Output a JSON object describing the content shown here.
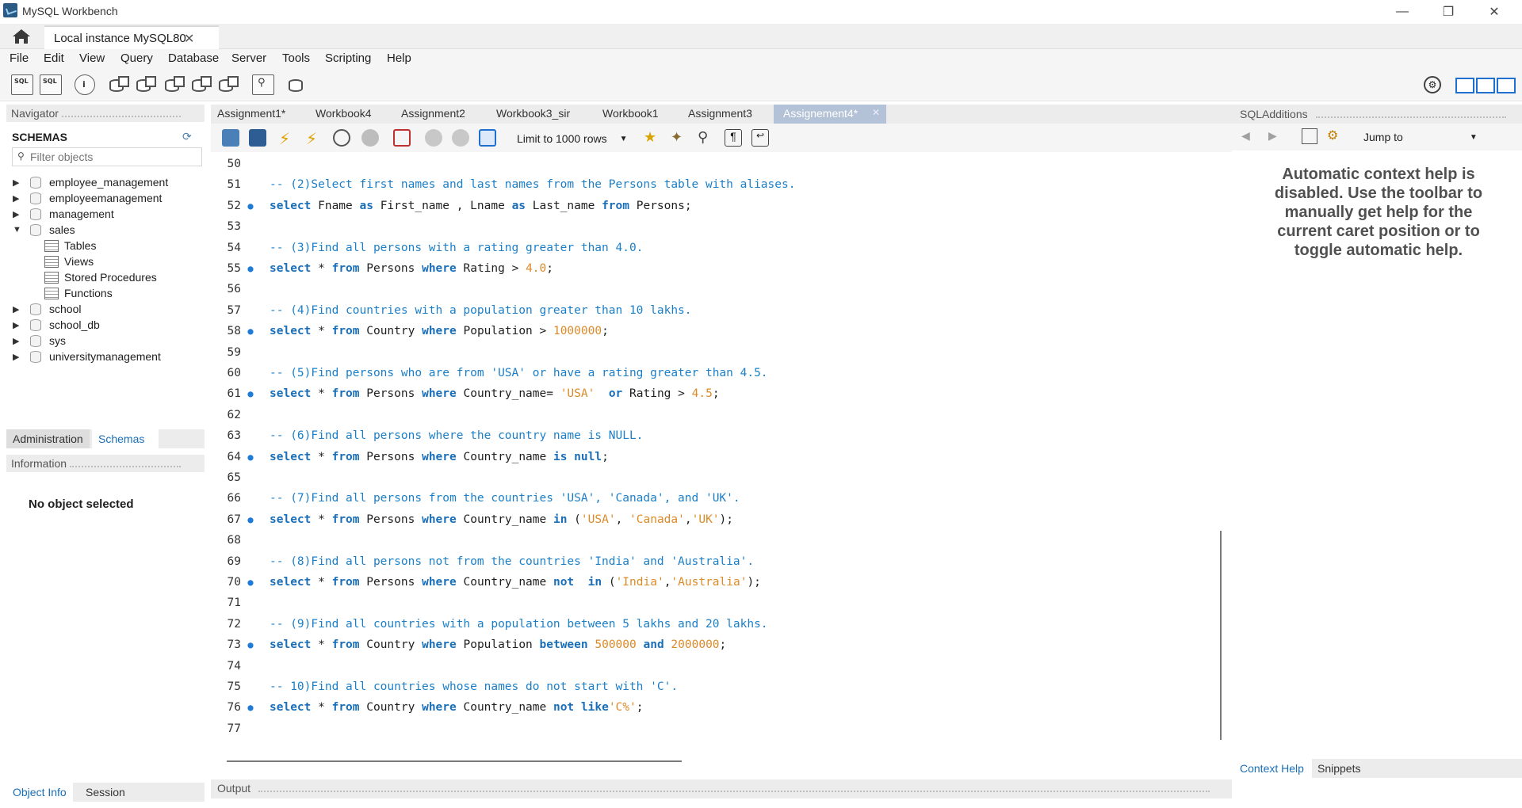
{
  "window": {
    "title": "MySQL Workbench",
    "connection_tab": "Local instance MySQL80"
  },
  "menu": [
    "File",
    "Edit",
    "View",
    "Query",
    "Database",
    "Server",
    "Tools",
    "Scripting",
    "Help"
  ],
  "toolbar_icons": [
    "new-sql-tab-icon",
    "open-sql-script-icon",
    "inspector-icon",
    "create-schema-icon",
    "create-table-icon",
    "create-view-icon",
    "create-procedure-icon",
    "create-function-icon",
    "search-table-data-icon",
    "reconnect-icon"
  ],
  "navigator": {
    "header": "Navigator",
    "schemas_label": "SCHEMAS",
    "filter_placeholder": "Filter objects",
    "schemas": [
      "employee_management",
      "employeemanagement",
      "management",
      "sales",
      "school",
      "school_db",
      "sys",
      "universitymanagement"
    ],
    "sales_children": [
      "Tables",
      "Views",
      "Stored Procedures",
      "Functions"
    ],
    "tabs": [
      "Administration",
      "Schemas"
    ],
    "information_header": "Information",
    "no_object": "No object selected",
    "bottom_tabs": [
      "Object Info",
      "Session"
    ]
  },
  "editor": {
    "tabs": [
      "Assignment1*",
      "Workbook4",
      "Assignment2",
      "Workbook3_sir",
      "Workbook1",
      "Assignment3"
    ],
    "active_tab": "Assignement4*",
    "limit_label": "Limit to 1000 rows",
    "output_label": "Output"
  },
  "code": [
    {
      "n": "50",
      "bp": false,
      "parts": []
    },
    {
      "n": "51",
      "bp": false,
      "parts": [
        [
          "cm",
          "-- (2)Select first names and last names from the Persons table with aliases."
        ]
      ]
    },
    {
      "n": "52",
      "bp": true,
      "parts": [
        [
          "kw",
          "select"
        ],
        [
          "ident",
          " Fname "
        ],
        [
          "kw",
          "as"
        ],
        [
          "ident",
          " First_name , Lname "
        ],
        [
          "kw",
          "as"
        ],
        [
          "ident",
          " Last_name "
        ],
        [
          "kw",
          "from"
        ],
        [
          "ident",
          " Persons;"
        ]
      ]
    },
    {
      "n": "53",
      "bp": false,
      "parts": []
    },
    {
      "n": "54",
      "bp": false,
      "parts": [
        [
          "cm",
          "-- (3)Find all persons with a rating greater than 4.0."
        ]
      ]
    },
    {
      "n": "55",
      "bp": true,
      "parts": [
        [
          "kw",
          "select"
        ],
        [
          "ident",
          " * "
        ],
        [
          "kw",
          "from"
        ],
        [
          "ident",
          " Persons "
        ],
        [
          "kw",
          "where"
        ],
        [
          "ident",
          " Rating > "
        ],
        [
          "num",
          "4.0"
        ],
        [
          "ident",
          ";"
        ]
      ]
    },
    {
      "n": "56",
      "bp": false,
      "parts": []
    },
    {
      "n": "57",
      "bp": false,
      "parts": [
        [
          "cm",
          "-- (4)Find countries with a population greater than 10 lakhs."
        ]
      ]
    },
    {
      "n": "58",
      "bp": true,
      "parts": [
        [
          "kw",
          "select"
        ],
        [
          "ident",
          " * "
        ],
        [
          "kw",
          "from"
        ],
        [
          "ident",
          " Country "
        ],
        [
          "kw",
          "where"
        ],
        [
          "ident",
          " Population > "
        ],
        [
          "num",
          "1000000"
        ],
        [
          "ident",
          ";"
        ]
      ]
    },
    {
      "n": "59",
      "bp": false,
      "parts": []
    },
    {
      "n": "60",
      "bp": false,
      "parts": [
        [
          "cm",
          "-- (5)Find persons who are from 'USA' or have a rating greater than 4.5."
        ]
      ]
    },
    {
      "n": "61",
      "bp": true,
      "parts": [
        [
          "kw",
          "select"
        ],
        [
          "ident",
          " * "
        ],
        [
          "kw",
          "from"
        ],
        [
          "ident",
          " Persons "
        ],
        [
          "kw",
          "where"
        ],
        [
          "ident",
          " Country_name= "
        ],
        [
          "str",
          "'USA'"
        ],
        [
          "ident",
          "  "
        ],
        [
          "kw",
          "or"
        ],
        [
          "ident",
          " Rating > "
        ],
        [
          "num",
          "4.5"
        ],
        [
          "ident",
          ";"
        ]
      ]
    },
    {
      "n": "62",
      "bp": false,
      "parts": []
    },
    {
      "n": "63",
      "bp": false,
      "parts": [
        [
          "cm",
          "-- (6)Find all persons where the country name is NULL."
        ]
      ]
    },
    {
      "n": "64",
      "bp": true,
      "parts": [
        [
          "kw",
          "select"
        ],
        [
          "ident",
          " * "
        ],
        [
          "kw",
          "from"
        ],
        [
          "ident",
          " Persons "
        ],
        [
          "kw",
          "where"
        ],
        [
          "ident",
          " Country_name "
        ],
        [
          "kw",
          "is null"
        ],
        [
          "ident",
          ";"
        ]
      ]
    },
    {
      "n": "65",
      "bp": false,
      "parts": []
    },
    {
      "n": "66",
      "bp": false,
      "parts": [
        [
          "cm",
          "-- (7)Find all persons from the countries 'USA', 'Canada', and 'UK'."
        ]
      ]
    },
    {
      "n": "67",
      "bp": true,
      "parts": [
        [
          "kw",
          "select"
        ],
        [
          "ident",
          " * "
        ],
        [
          "kw",
          "from"
        ],
        [
          "ident",
          " Persons "
        ],
        [
          "kw",
          "where"
        ],
        [
          "ident",
          " Country_name "
        ],
        [
          "kw",
          "in"
        ],
        [
          "ident",
          " ("
        ],
        [
          "str",
          "'USA'"
        ],
        [
          "ident",
          ", "
        ],
        [
          "str",
          "'Canada'"
        ],
        [
          "ident",
          ","
        ],
        [
          "str",
          "'UK'"
        ],
        [
          "ident",
          ");"
        ]
      ]
    },
    {
      "n": "68",
      "bp": false,
      "parts": []
    },
    {
      "n": "69",
      "bp": false,
      "parts": [
        [
          "cm",
          "-- (8)Find all persons not from the countries 'India' and 'Australia'."
        ]
      ]
    },
    {
      "n": "70",
      "bp": true,
      "parts": [
        [
          "kw",
          "select"
        ],
        [
          "ident",
          " * "
        ],
        [
          "kw",
          "from"
        ],
        [
          "ident",
          " Persons "
        ],
        [
          "kw",
          "where"
        ],
        [
          "ident",
          " Country_name "
        ],
        [
          "kw",
          "not"
        ],
        [
          "ident",
          "  "
        ],
        [
          "kw",
          "in"
        ],
        [
          "ident",
          " ("
        ],
        [
          "str",
          "'India'"
        ],
        [
          "ident",
          ","
        ],
        [
          "str",
          "'Australia'"
        ],
        [
          "ident",
          ");"
        ]
      ]
    },
    {
      "n": "71",
      "bp": false,
      "parts": []
    },
    {
      "n": "72",
      "bp": false,
      "parts": [
        [
          "cm",
          "-- (9)Find all countries with a population between 5 lakhs and 20 lakhs."
        ]
      ]
    },
    {
      "n": "73",
      "bp": true,
      "parts": [
        [
          "kw",
          "select"
        ],
        [
          "ident",
          " * "
        ],
        [
          "kw",
          "from"
        ],
        [
          "ident",
          " Country "
        ],
        [
          "kw",
          "where"
        ],
        [
          "ident",
          " Population "
        ],
        [
          "kw",
          "between"
        ],
        [
          "ident",
          " "
        ],
        [
          "num",
          "500000"
        ],
        [
          "ident",
          " "
        ],
        [
          "kw",
          "and"
        ],
        [
          "ident",
          " "
        ],
        [
          "num",
          "2000000"
        ],
        [
          "ident",
          ";"
        ]
      ]
    },
    {
      "n": "74",
      "bp": false,
      "parts": []
    },
    {
      "n": "75",
      "bp": false,
      "parts": [
        [
          "cm",
          "-- 10)Find all countries whose names do not start with 'C'."
        ]
      ]
    },
    {
      "n": "76",
      "bp": true,
      "parts": [
        [
          "kw",
          "select"
        ],
        [
          "ident",
          " * "
        ],
        [
          "kw",
          "from"
        ],
        [
          "ident",
          " Country "
        ],
        [
          "kw",
          "where"
        ],
        [
          "ident",
          " Country_name "
        ],
        [
          "kw",
          "not like"
        ],
        [
          "str",
          "'C%'"
        ],
        [
          "ident",
          ";"
        ]
      ]
    },
    {
      "n": "77",
      "bp": false,
      "parts": []
    }
  ],
  "sql_additions": {
    "header": "SQLAdditions",
    "jump_to": "Jump to",
    "help_message": "Automatic context help is disabled. Use the toolbar to manually get help for the current caret position or to toggle automatic help.",
    "tabs": [
      "Context Help",
      "Snippets"
    ]
  },
  "colors": {
    "comment": "#1b7fc8",
    "keyword": "#1a6fb8",
    "string": "#dc8a28",
    "active_tab": "#b3c2d6",
    "breakpoint": "#1e7bd8"
  }
}
